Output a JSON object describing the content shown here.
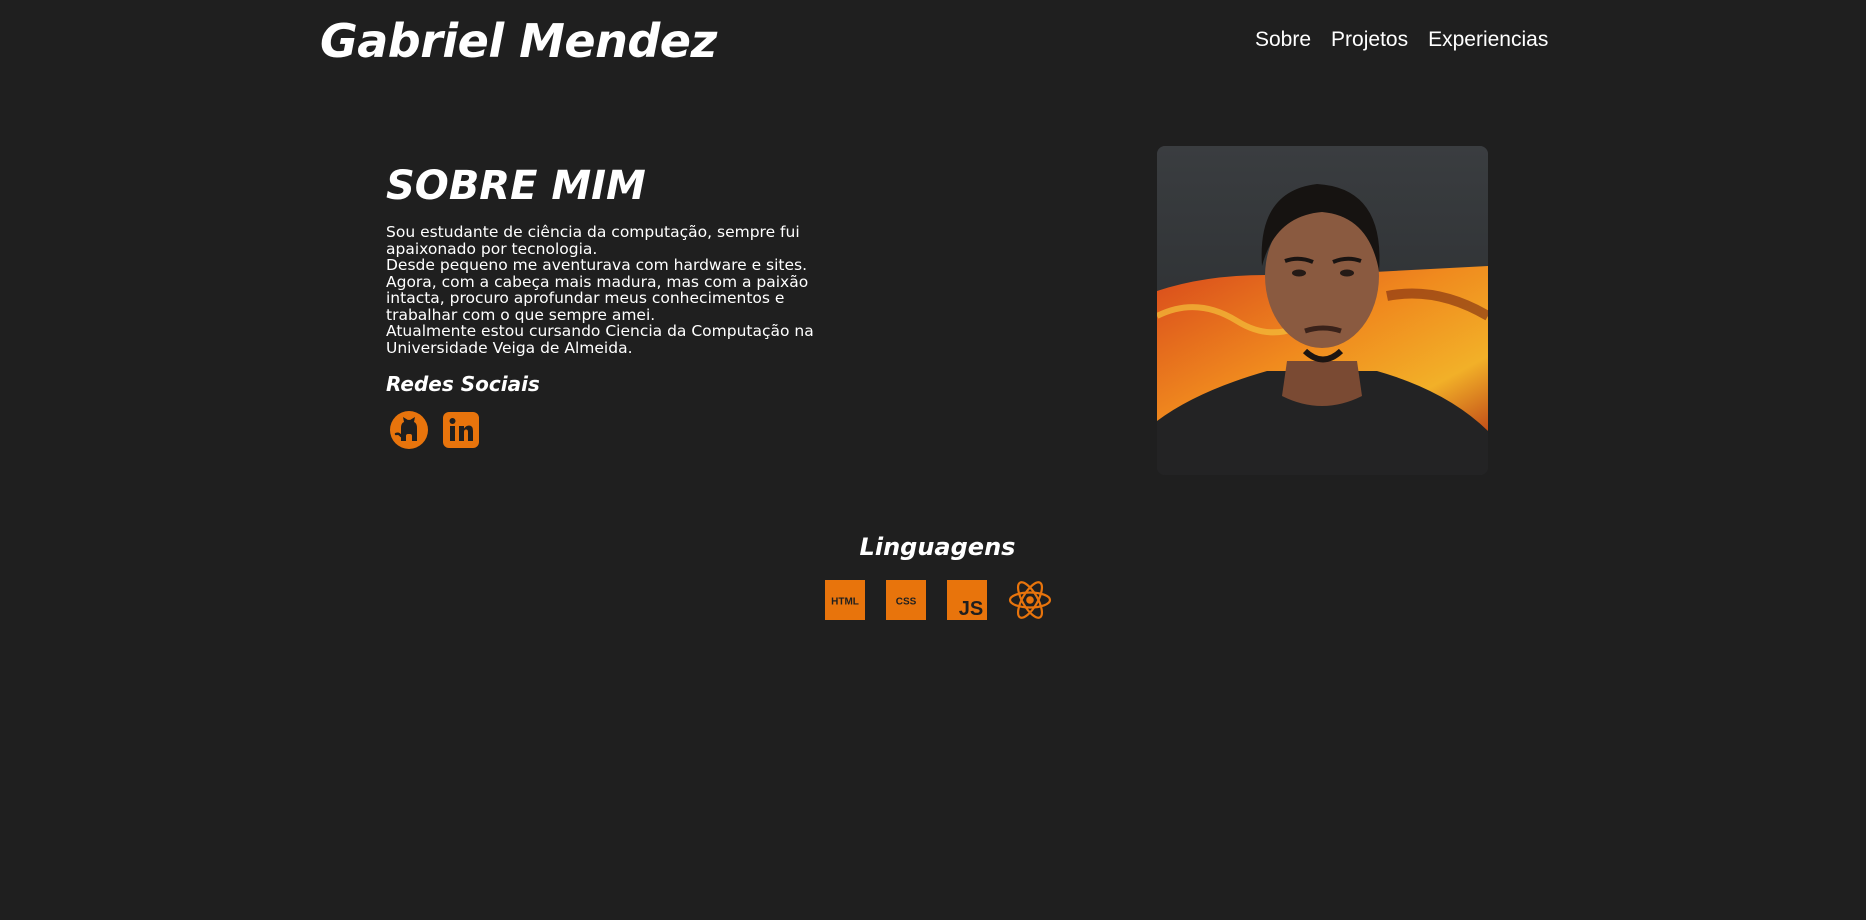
{
  "header": {
    "logo": "Gabriel Mendez",
    "nav": [
      "Sobre",
      "Projetos",
      "Experiencias"
    ]
  },
  "about": {
    "title": "SOBRE MIM",
    "paragraphs": [
      "Sou estudante de ciência da computação, sempre fui apaixonado por tecnologia.",
      "Desde pequeno me aventurava com hardware e sites.",
      "Agora, com a cabeça mais madura, mas com a paixão intacta, procuro aprofundar meus conhecimentos e trabalhar com o que sempre amei.",
      "Atualmente estou cursando Ciencia da Computação na Universidade Veiga de Almeida."
    ],
    "social_title": "Redes Sociais",
    "social_icons": [
      "github-icon",
      "linkedin-icon"
    ]
  },
  "languages": {
    "title": "Linguagens",
    "icons": [
      {
        "name": "html-icon",
        "label": "HTML"
      },
      {
        "name": "css-icon",
        "label": "CSS"
      },
      {
        "name": "js-icon",
        "label": "JS"
      },
      {
        "name": "react-icon",
        "label": ""
      }
    ]
  },
  "colors": {
    "background": "#1f1f1f",
    "text": "#ffffff",
    "accent": "#e8740c"
  }
}
